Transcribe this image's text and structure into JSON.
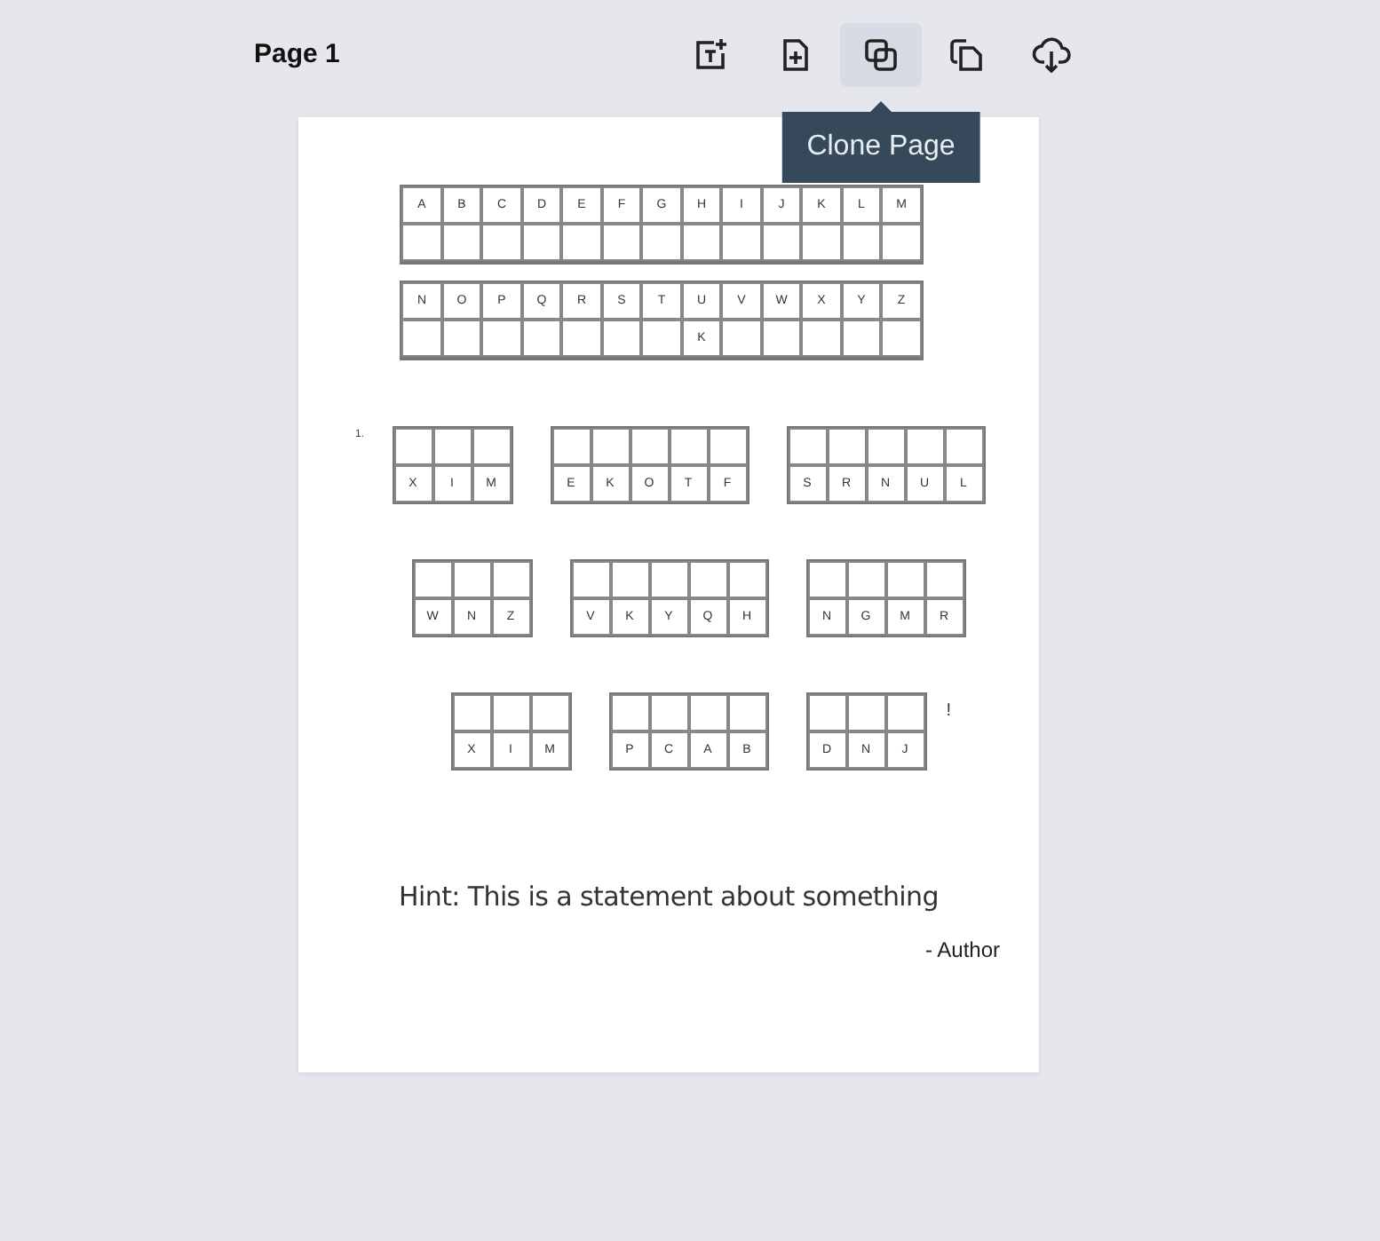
{
  "page_title": "Page 1",
  "toolbar": [
    {
      "kind": "add-text",
      "selected": false
    },
    {
      "kind": "add-page",
      "selected": false
    },
    {
      "kind": "clone",
      "selected": true,
      "tooltip": "Clone Page"
    },
    {
      "kind": "copy",
      "selected": false
    },
    {
      "kind": "download",
      "selected": false
    }
  ],
  "key_rows": [
    [
      {
        "letter": "A"
      },
      {
        "letter": "B"
      },
      {
        "letter": "C"
      },
      {
        "letter": "D"
      },
      {
        "letter": "E"
      },
      {
        "letter": "F"
      },
      {
        "letter": "G"
      },
      {
        "letter": "H"
      },
      {
        "letter": "I"
      },
      {
        "letter": "J"
      },
      {
        "letter": "K"
      },
      {
        "letter": "L"
      },
      {
        "letter": "M"
      }
    ],
    [
      {
        "letter": "N"
      },
      {
        "letter": "O"
      },
      {
        "letter": "P"
      },
      {
        "letter": "Q"
      },
      {
        "letter": "R"
      },
      {
        "letter": "S"
      },
      {
        "letter": "T"
      },
      {
        "letter": "U",
        "answer": "K"
      },
      {
        "letter": "V"
      },
      {
        "letter": "W"
      },
      {
        "letter": "X"
      },
      {
        "letter": "Y"
      },
      {
        "letter": "Z"
      }
    ]
  ],
  "puzzle_number": "1.",
  "puzzle_lines": [
    {
      "words": [
        [
          "X",
          "I",
          "M"
        ],
        [
          "E",
          "K",
          "O",
          "T",
          "F"
        ],
        [
          "S",
          "R",
          "N",
          "U",
          "L"
        ]
      ]
    },
    {
      "words": [
        [
          "W",
          "N",
          "Z"
        ],
        [
          "V",
          "K",
          "Y",
          "Q",
          "H"
        ],
        [
          "N",
          "G",
          "M",
          "R"
        ]
      ]
    },
    {
      "words": [
        [
          "X",
          "I",
          "M"
        ],
        [
          "P",
          "C",
          "A",
          "B"
        ],
        [
          "D",
          "N",
          "J"
        ]
      ],
      "punctuation": "!"
    }
  ],
  "hint": "Hint: This is a statement about something",
  "author": "- Author"
}
